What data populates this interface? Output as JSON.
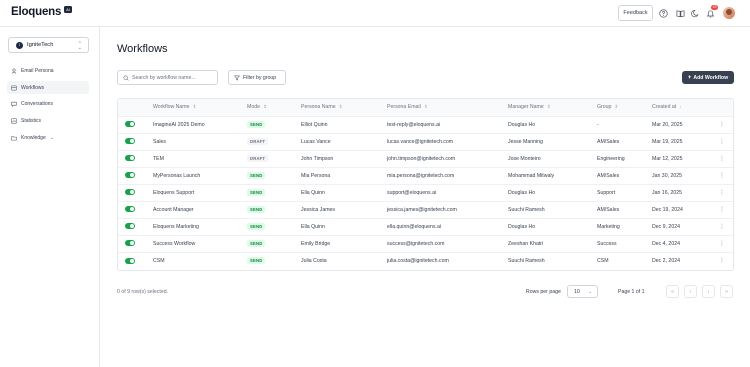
{
  "app": {
    "logo_text": "Eloquens",
    "logo_badge": "AI"
  },
  "header": {
    "feedback_label": "Feedback",
    "notification_count": "15",
    "icons": [
      "help-icon",
      "book-icon",
      "moon-icon",
      "bell-icon"
    ]
  },
  "sidebar": {
    "org": {
      "initial": "I",
      "name": "IgniteTech"
    },
    "items": [
      {
        "label": "Email Persona",
        "icon": "user-icon",
        "active": false
      },
      {
        "label": "Workflows",
        "icon": "workflow-icon",
        "active": true
      },
      {
        "label": "Conversations",
        "icon": "chat-icon",
        "active": false
      },
      {
        "label": "Statistics",
        "icon": "chart-icon",
        "active": false
      },
      {
        "label": "Knowledge",
        "icon": "folder-icon",
        "active": false
      }
    ]
  },
  "main": {
    "title": "Workflows",
    "search_placeholder": "Search by workflow name...",
    "filter_label": "Filter by group",
    "add_label": "Add Workflow"
  },
  "table": {
    "columns": [
      "Workflow Name",
      "Mode",
      "Persona Name",
      "Persona Email",
      "Manager Name",
      "Group",
      "Created at"
    ],
    "rows": [
      {
        "enabled": true,
        "name": "ImagineAI 2025 Demo",
        "mode": "SEND",
        "persona": "Elliot Quinn",
        "email": "test-reply@eloquens.ai",
        "manager": "Douglas Ho",
        "group": "-",
        "created": "Mar 20, 2025"
      },
      {
        "enabled": true,
        "name": "Sales",
        "mode": "DRAFT",
        "persona": "Lucas Vance",
        "email": "lucas.vance@ignitetech.com",
        "manager": "Jesse Manning",
        "group": "AM/Sales",
        "created": "Mar 19, 2025"
      },
      {
        "enabled": true,
        "name": "TEM",
        "mode": "DRAFT",
        "persona": "John Timpson",
        "email": "john.timpson@ignitetech.com",
        "manager": "Jose Monteiro",
        "group": "Engineering",
        "created": "Mar 12, 2025"
      },
      {
        "enabled": true,
        "name": "MyPersonas Launch",
        "mode": "SEND",
        "persona": "Mia Persona",
        "email": "mia.persona@ignitetech.com",
        "manager": "Mohammad Mitwaly",
        "group": "AM/Sales",
        "created": "Jan 30, 2025"
      },
      {
        "enabled": true,
        "name": "Eloquens Support",
        "mode": "SEND",
        "persona": "Ella Quinn",
        "email": "support@eloquens.ai",
        "manager": "Douglas Ho",
        "group": "Support",
        "created": "Jan 16, 2025"
      },
      {
        "enabled": true,
        "name": "Account Manager",
        "mode": "SEND",
        "persona": "Jessica James",
        "email": "jessica.james@ignitetech.com",
        "manager": "Suuchi Ramesh",
        "group": "AM/Sales",
        "created": "Dec 19, 2024"
      },
      {
        "enabled": true,
        "name": "Eloquens Marketing",
        "mode": "SEND",
        "persona": "Ella Quinn",
        "email": "ella.quinn@eloquens.ai",
        "manager": "Douglas Ho",
        "group": "Marketing",
        "created": "Dec 9, 2024"
      },
      {
        "enabled": true,
        "name": "Success Workflow",
        "mode": "SEND",
        "persona": "Emily Bridge",
        "email": "success@ignitetech.com",
        "manager": "Zeeshan Khatri",
        "group": "Success",
        "created": "Dec 4, 2024"
      },
      {
        "enabled": true,
        "name": "CSM",
        "mode": "SEND",
        "persona": "Julia Costa",
        "email": "julia.costa@ignitetech.com",
        "manager": "Suuchi Ramesh",
        "group": "CSM",
        "created": "Dec 2, 2024"
      }
    ]
  },
  "footer": {
    "selection_text": "0 of 9 row(s) selected.",
    "rows_per_page_label": "Rows per page",
    "rows_per_page_value": "10",
    "page_text": "Page 1 of 1"
  },
  "colors": {
    "accent_green": "#16a34a",
    "primary_button": "#374151",
    "send_badge_bg": "#dcfce7",
    "draft_badge_bg": "#f3f4f6"
  }
}
